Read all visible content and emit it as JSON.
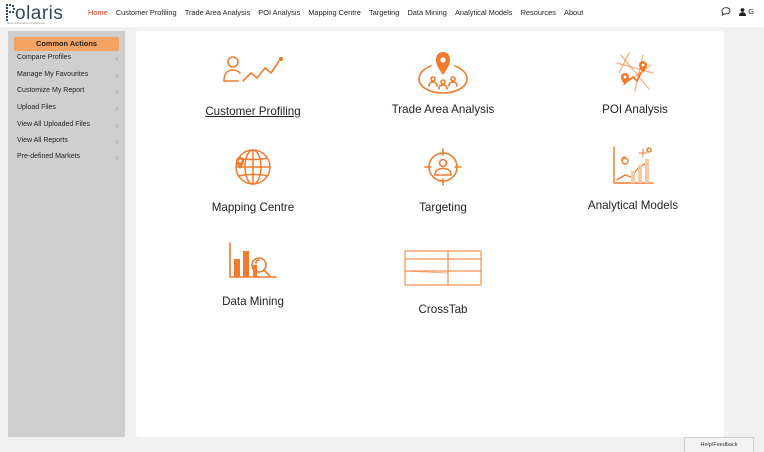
{
  "brand": {
    "name": "olaris",
    "subtitle": "Next Generation Intelligence"
  },
  "nav": [
    {
      "label": "Home",
      "active": true
    },
    {
      "label": "Customer Profiling"
    },
    {
      "label": "Trade Area Analysis"
    },
    {
      "label": "POI Analysis"
    },
    {
      "label": "Mapping Centre"
    },
    {
      "label": "Targeting"
    },
    {
      "label": "Data Mining"
    },
    {
      "label": "Analytical Models"
    },
    {
      "label": "Resources"
    },
    {
      "label": "About"
    }
  ],
  "user": {
    "initial": "G"
  },
  "sidebar": {
    "header": "Common Actions",
    "items": [
      "Compare Profiles",
      "Manage My Favourites",
      "Customize My Report",
      "Upload Files",
      "View All Uploaded Files",
      "View All Reports",
      "Pre-defined Markets"
    ],
    "chevron": "›"
  },
  "tiles": [
    {
      "label": "Customer Profiling",
      "icon": "customer-profiling-icon"
    },
    {
      "label": "Trade Area Analysis",
      "icon": "trade-area-icon"
    },
    {
      "label": "POI Analysis",
      "icon": "poi-icon"
    },
    {
      "label": "Mapping Centre",
      "icon": "globe-icon"
    },
    {
      "label": "Targeting",
      "icon": "target-icon"
    },
    {
      "label": "Analytical Models",
      "icon": "analytics-icon"
    },
    {
      "label": "Data Mining",
      "icon": "data-mining-icon"
    },
    {
      "label": "CrossTab",
      "icon": "crosstab-icon"
    }
  ],
  "help_label": "Help/Feedback",
  "colors": {
    "accent": "#f07b2e",
    "sidebar_header": "#f4a460",
    "nav_active": "#d9381e"
  }
}
